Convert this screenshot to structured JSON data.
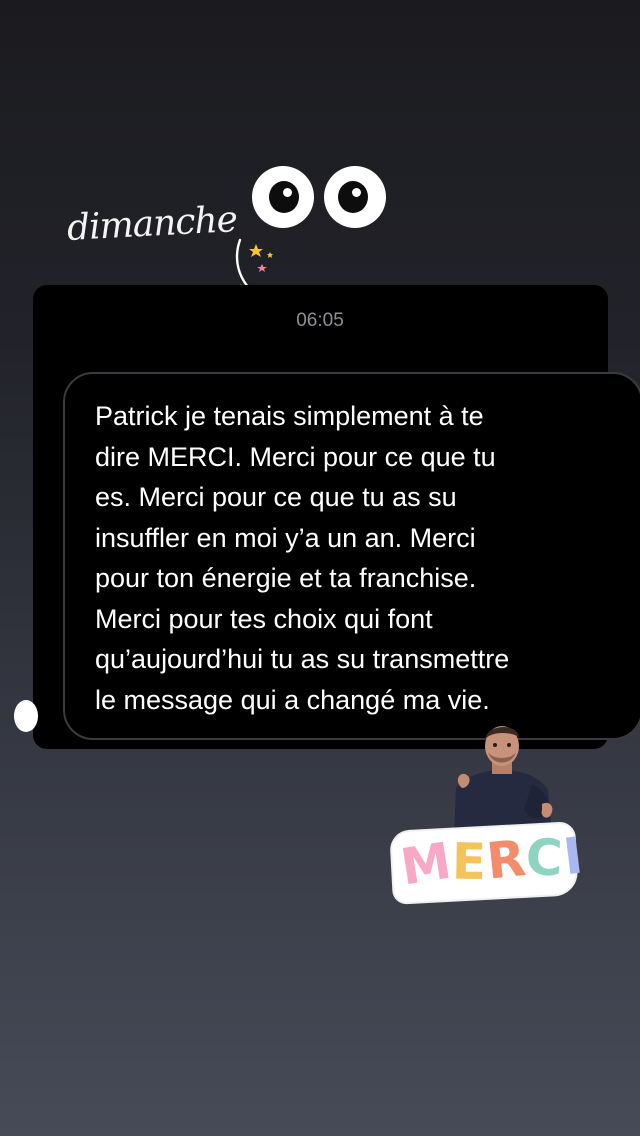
{
  "story": {
    "handwritten_label": "dimanche",
    "message_card": {
      "timestamp": "06:05",
      "message": "Patrick je tenais simplement à te\ndire MERCI. Merci pour ce que tu\nes. Merci pour ce que tu as su\ninsuffler en moi y’a un an. Merci\npour ton énergie et ta franchise.\nMerci pour tes choix qui font\nqu’aujourd’hui tu as su transmettre\nle message qui a changé ma vie."
    },
    "stickers": {
      "eyes": "eyes-sticker",
      "person": "man-gif-sticker",
      "merci_text": "MERCI",
      "merci_letters": [
        "M",
        "E",
        "R",
        "C",
        "I"
      ]
    }
  },
  "colors": {
    "background_top": "#1b1b1f",
    "background_bottom": "#474b57",
    "card_background": "#000000",
    "bubble_border": "#3b3b3f",
    "timestamp": "#8e8e93",
    "text": "#ffffff"
  }
}
